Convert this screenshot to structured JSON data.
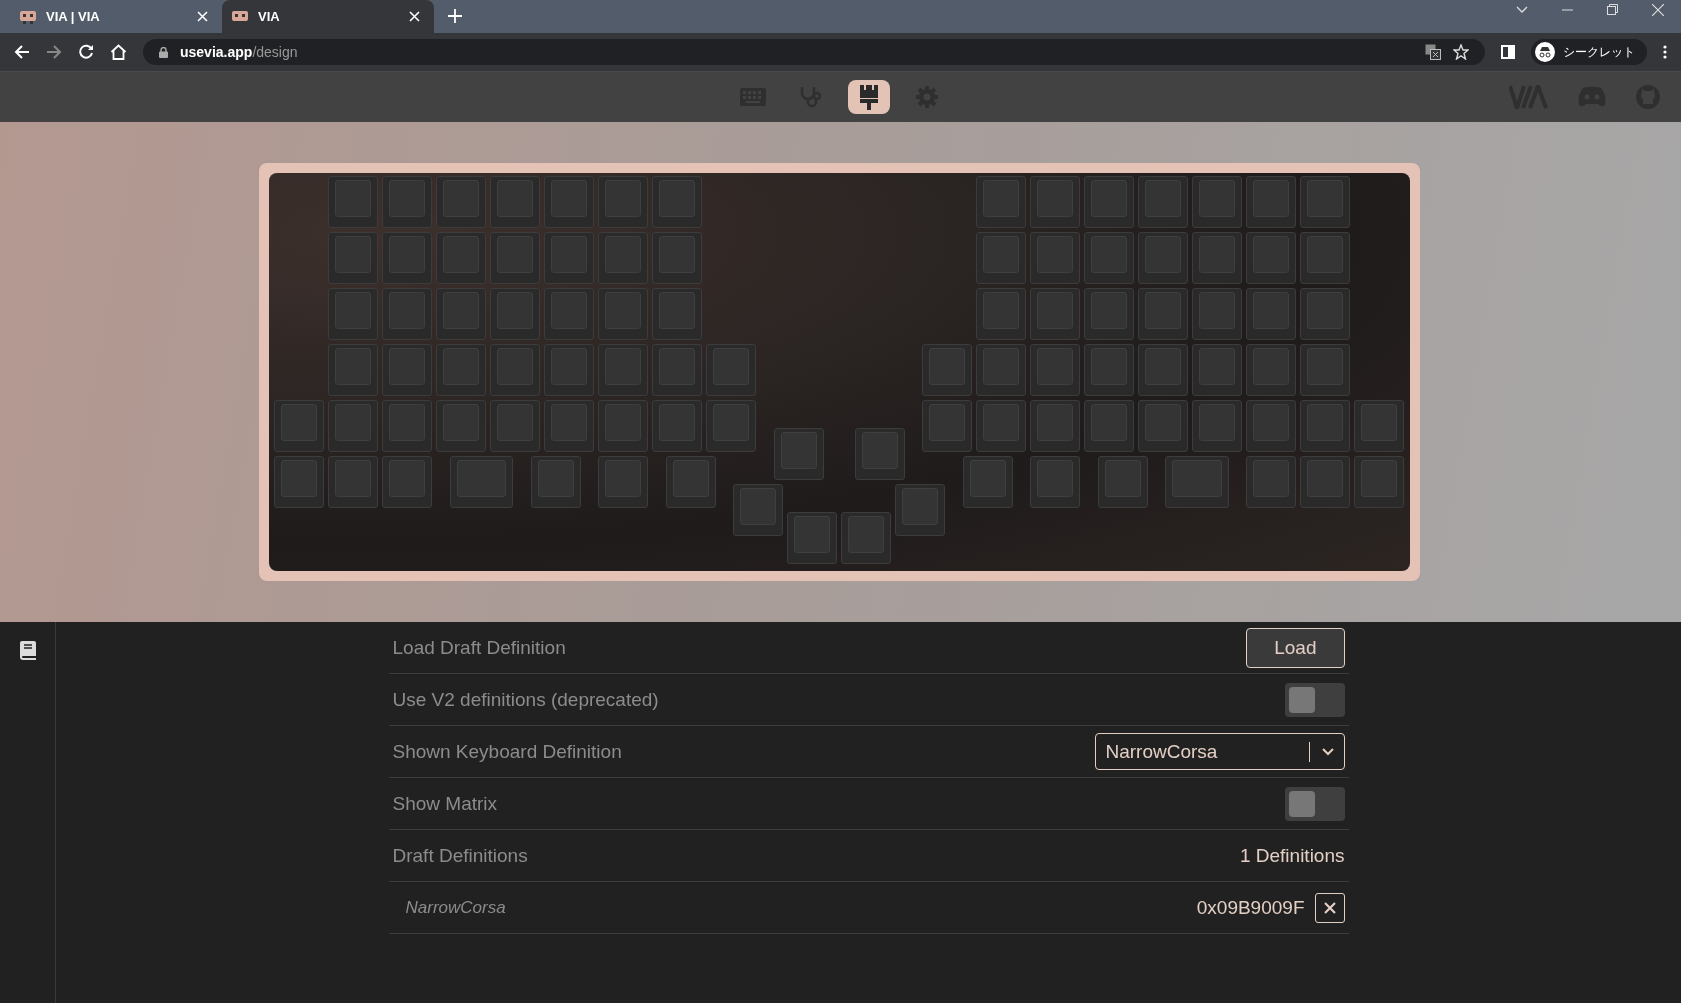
{
  "browser": {
    "tabs": [
      {
        "title": "VIA | VIA",
        "selected": false
      },
      {
        "title": "VIA",
        "selected": true
      }
    ],
    "url": {
      "host": "usevia.app",
      "path": "/design"
    },
    "forward_disabled": true,
    "profile": "シークレット"
  },
  "header": {
    "nav": [
      {
        "selected": false
      },
      {
        "selected": false
      },
      {
        "selected": true
      },
      {
        "selected": false
      }
    ]
  },
  "settings": [
    {
      "kind": "button",
      "label": "Load Draft Definition",
      "button": "Load"
    },
    {
      "kind": "toggle",
      "label": "Use V2 definitions (deprecated)",
      "on": false
    },
    {
      "kind": "select",
      "label": "Shown Keyboard Definition",
      "value": "NarrowCorsa"
    },
    {
      "kind": "toggle",
      "label": "Show Matrix",
      "on": false
    },
    {
      "kind": "count",
      "label": "Draft Definitions",
      "value": "1 Definitions"
    },
    {
      "kind": "definition",
      "label": "NarrowCorsa",
      "value": "0x09B9009F"
    }
  ]
}
